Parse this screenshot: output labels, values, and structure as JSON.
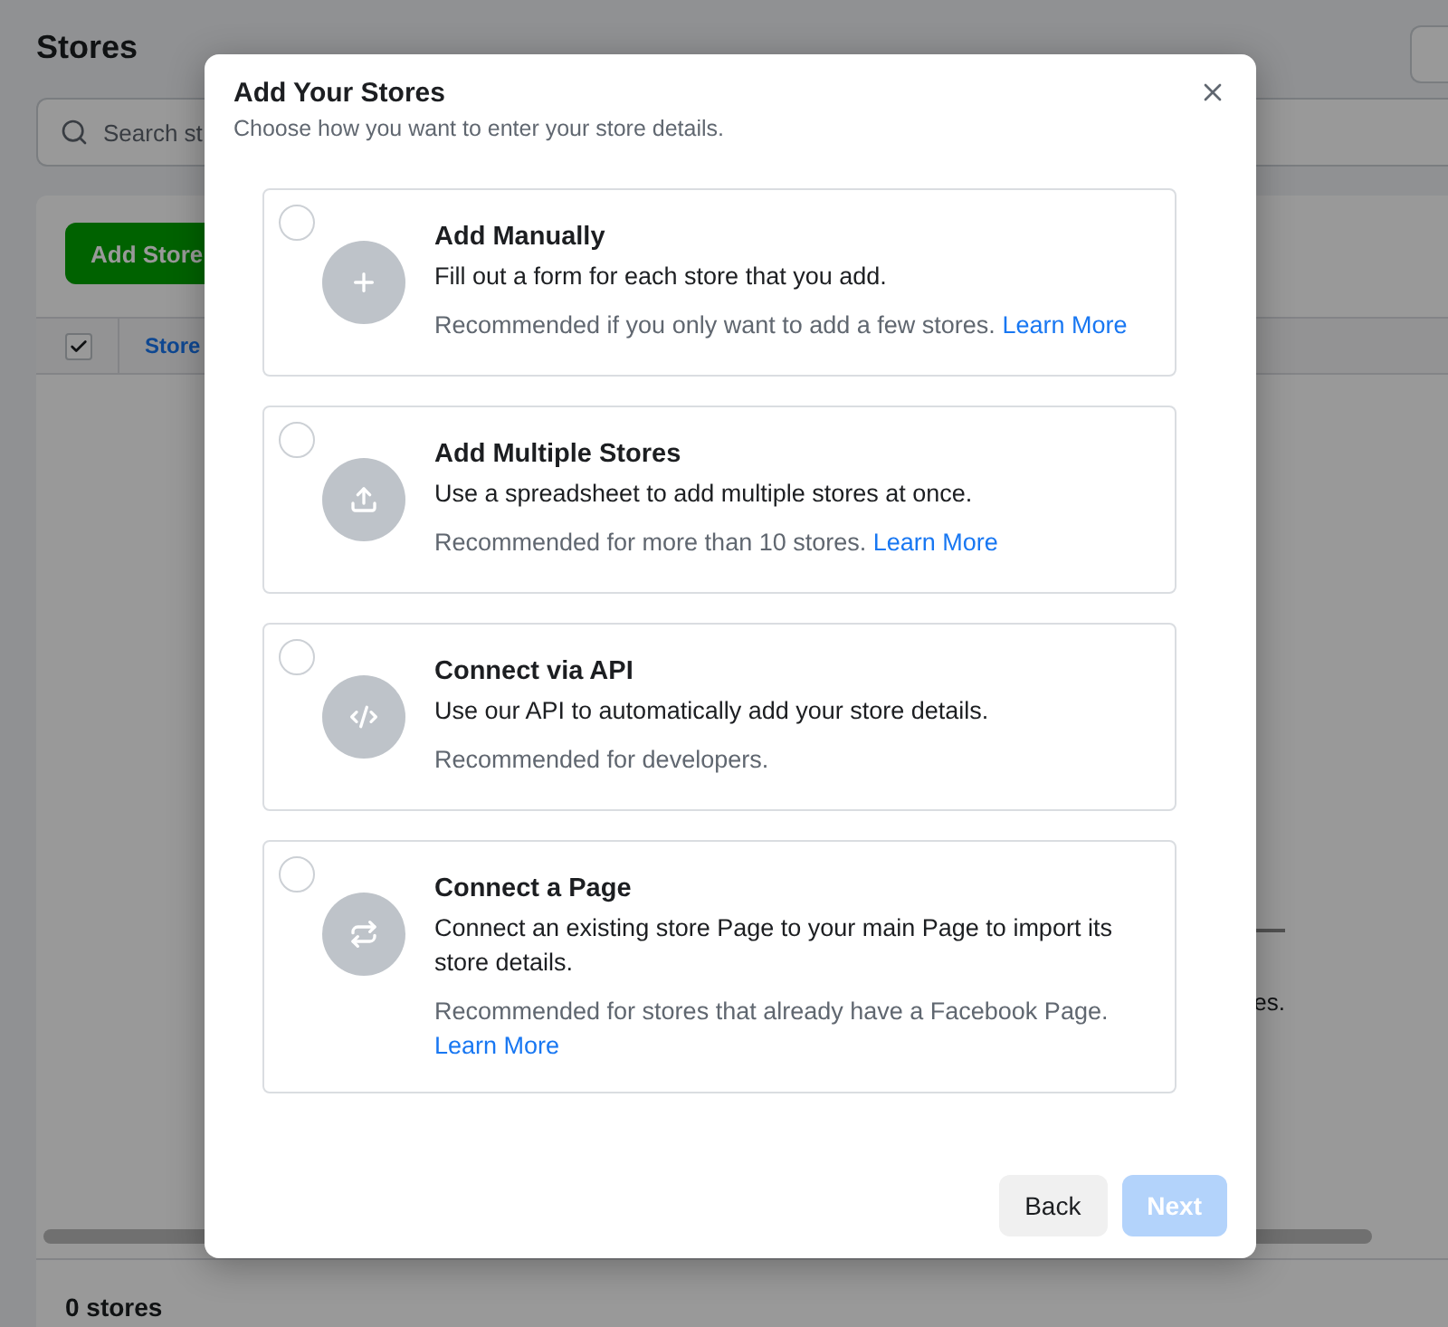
{
  "page": {
    "title": "Stores",
    "search": {
      "placeholder": "Search st"
    },
    "add_button": "Add Store",
    "table": {
      "select_all": {
        "checked": true
      },
      "columns": [
        "Store"
      ]
    },
    "empty_text": "es.",
    "footer": "0 stores"
  },
  "dialog": {
    "title": "Add Your Stores",
    "subtitle": "Choose how you want to enter your store details.",
    "options": [
      {
        "kind": "manual",
        "title": "Add Manually",
        "description": "Fill out a form for each store that you add.",
        "note": "Recommended if you only want to add a few stores.",
        "link": "Learn More",
        "selected": false
      },
      {
        "kind": "upload",
        "title": "Add Multiple Stores",
        "description": "Use a spreadsheet to add multiple stores at once.",
        "note": "Recommended for more than 10 stores.",
        "link": "Learn More",
        "selected": false
      },
      {
        "kind": "api",
        "title": "Connect via API",
        "description": "Use our API to automatically add your store details.",
        "note": "Recommended for developers.",
        "selected": false
      },
      {
        "kind": "page",
        "title": "Connect a Page",
        "description": "Connect an existing store Page to your main Page to import its store details.",
        "note": "Recommended for stores that already have a Facebook Page.",
        "link": "Learn More",
        "selected": false
      }
    ],
    "buttons": [
      {
        "label": "Back",
        "disabled": false
      },
      {
        "label": "Next",
        "disabled": true
      }
    ]
  }
}
